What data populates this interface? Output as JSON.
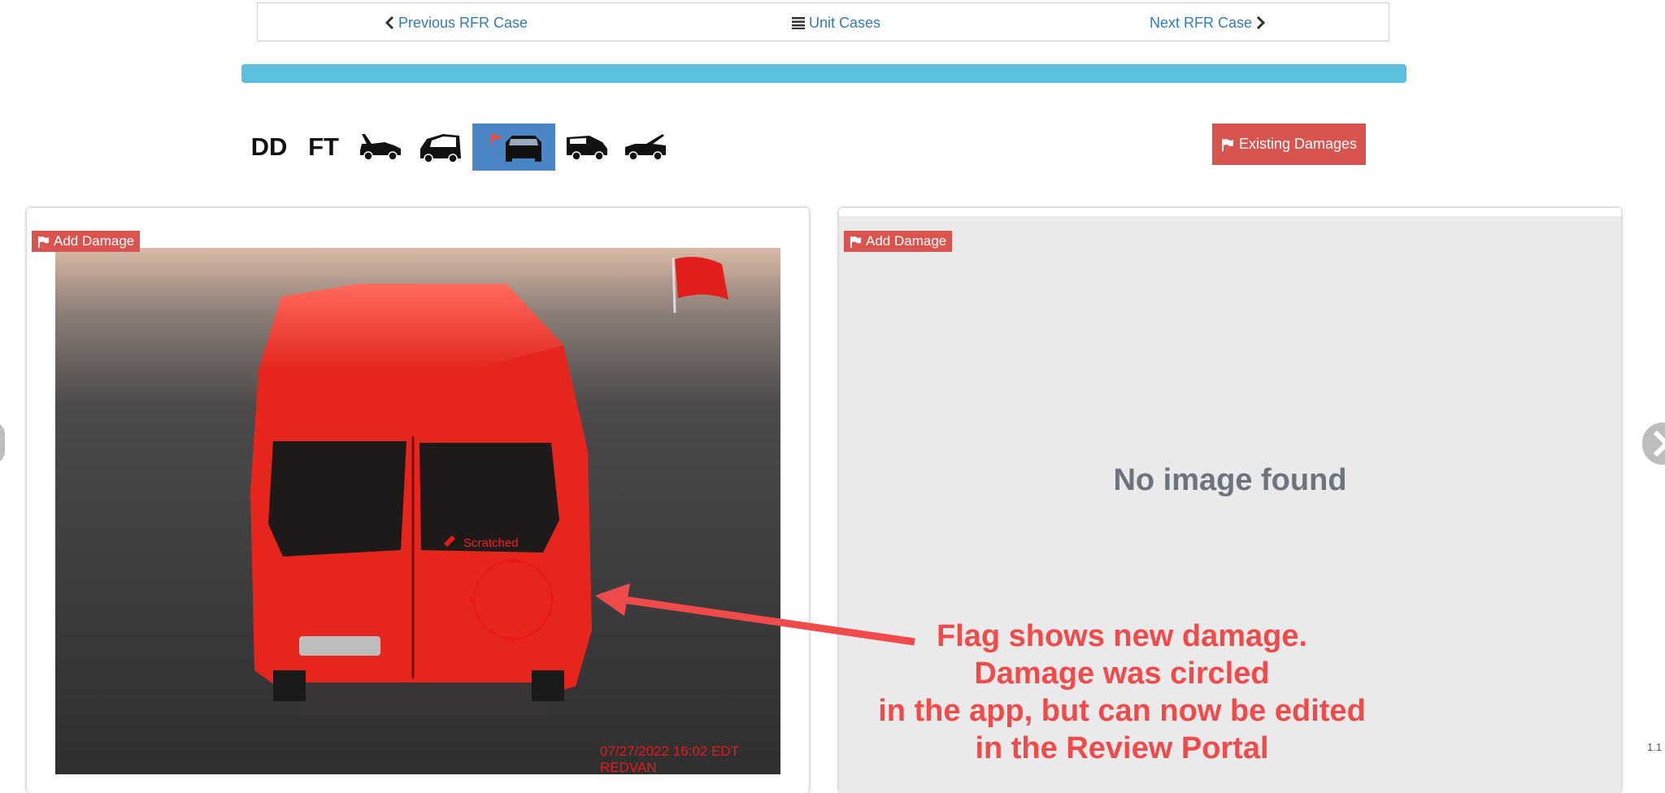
{
  "nav": {
    "previous_label": "Previous RFR Case",
    "unit_label": "Unit Cases",
    "next_label": "Next RFR Case"
  },
  "progress": {
    "value_percent": 100,
    "color": "#5bc0de"
  },
  "thumbnails": [
    {
      "label": "DD"
    },
    {
      "label": "FT"
    },
    {
      "icon": "car-side-open-icon"
    },
    {
      "icon": "car-front-open-icon"
    },
    {
      "icon": "car-rear-flagged-icon",
      "active": true
    },
    {
      "icon": "car-side-icon"
    },
    {
      "icon": "car-hood-open-icon"
    }
  ],
  "existing_damages_label": "Existing Damages",
  "left_panel": {
    "add_damage_label": "Add Damage",
    "damage_label": "Scratched",
    "timestamp": "07/27/2022 16:02 EDT",
    "vehicle": "REDVAN"
  },
  "right_panel": {
    "add_damage_label": "Add Damage",
    "no_image_text": "No image found"
  },
  "annotation": {
    "lines": [
      "Flag shows new damage.",
      "Damage was circled",
      "in the app, but can now be edited",
      "in the Review Portal"
    ],
    "color": "#f04b4b"
  },
  "version_text": "1.1",
  "colors": {
    "danger": "#d9534f",
    "link": "#337ab7",
    "active_thumb": "#4a86c5"
  }
}
